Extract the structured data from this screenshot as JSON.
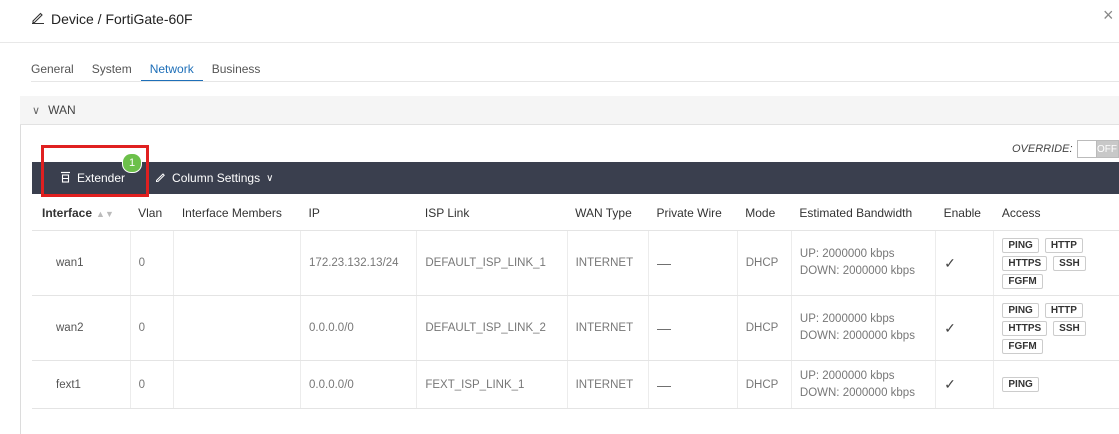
{
  "header": {
    "title": "Device / FortiGate-60F",
    "close": "×"
  },
  "tabs": [
    "General",
    "System",
    "Network",
    "Business"
  ],
  "active_tab": "Network",
  "section": {
    "title": "WAN"
  },
  "override": {
    "label": "OVERRIDE:",
    "state": "OFF"
  },
  "toolbar": {
    "extender_label": "Extender",
    "extender_badge": "1",
    "column_settings_label": "Column Settings"
  },
  "table": {
    "columns": [
      "Interface",
      "Vlan",
      "Interface Members",
      "IP",
      "ISP Link",
      "WAN Type",
      "Private Wire",
      "Mode",
      "Estimated Bandwidth",
      "Enable",
      "Access"
    ],
    "rows": [
      {
        "interface": "wan1",
        "vlan": "0",
        "members": "",
        "ip": "172.23.132.13/24",
        "isp_link": "DEFAULT_ISP_LINK_1",
        "wan_type": "INTERNET",
        "private_wire": "—",
        "mode": "DHCP",
        "bw_up": "UP: 2000000 kbps",
        "bw_down": "DOWN: 2000000 kbps",
        "enable": "✓",
        "access": [
          "PING",
          "HTTP",
          "HTTPS",
          "SSH",
          "FGFM"
        ]
      },
      {
        "interface": "wan2",
        "vlan": "0",
        "members": "",
        "ip": "0.0.0.0/0",
        "isp_link": "DEFAULT_ISP_LINK_2",
        "wan_type": "INTERNET",
        "private_wire": "—",
        "mode": "DHCP",
        "bw_up": "UP: 2000000 kbps",
        "bw_down": "DOWN: 2000000 kbps",
        "enable": "✓",
        "access": [
          "PING",
          "HTTP",
          "HTTPS",
          "SSH",
          "FGFM"
        ]
      },
      {
        "interface": "fext1",
        "vlan": "0",
        "members": "",
        "ip": "0.0.0.0/0",
        "isp_link": "FEXT_ISP_LINK_1",
        "wan_type": "INTERNET",
        "private_wire": "—",
        "mode": "DHCP",
        "bw_up": "UP: 2000000 kbps",
        "bw_down": "DOWN: 2000000 kbps",
        "enable": "✓",
        "access": [
          "PING"
        ]
      }
    ]
  }
}
